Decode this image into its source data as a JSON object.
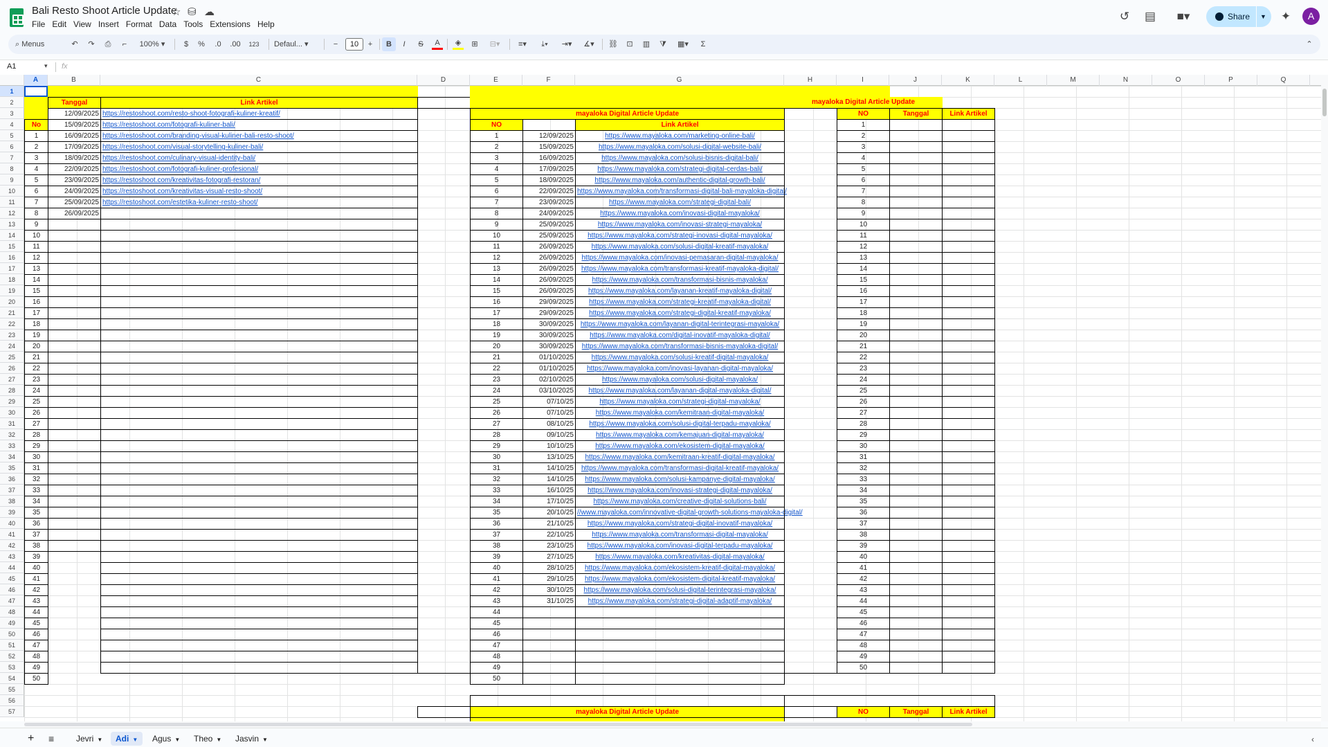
{
  "app": {
    "title": "Bali Resto Shoot Article Update",
    "menu": [
      "File",
      "Edit",
      "View",
      "Insert",
      "Format",
      "Data",
      "Tools",
      "Extensions",
      "Help"
    ],
    "share_label": "Share",
    "avatar_letter": "A",
    "accent": "#0b57d0"
  },
  "toolbar": {
    "search": "Menus",
    "zoom": "100%",
    "currency": "$",
    "percent": "%",
    "dec_less": ".0",
    "dec_more": ".00",
    "number_format": "123",
    "font": "Defaul...",
    "font_size": "10",
    "bold": "B",
    "italic": "I",
    "strike": "S",
    "text_color": "A",
    "sum": "Σ"
  },
  "formula": {
    "cell": "A1",
    "fx": "fx"
  },
  "columns": [
    "A",
    "B",
    "C",
    "D",
    "E",
    "F",
    "G",
    "H",
    "I",
    "J",
    "K",
    "L",
    "M",
    "N",
    "O",
    "P",
    "Q"
  ],
  "row_numbers": [
    "1",
    "2",
    "3",
    "4",
    "5",
    "6",
    "7",
    "8",
    "9",
    "10",
    "11",
    "12",
    "13",
    "14",
    "15",
    "16",
    "17",
    "18",
    "19",
    "20",
    "21",
    "22",
    "23",
    "24",
    "25",
    "26",
    "27",
    "28",
    "29",
    "30",
    "31",
    "32",
    "33",
    "34",
    "35",
    "36",
    "37",
    "38",
    "39",
    "40",
    "41",
    "42",
    "43",
    "44",
    "45",
    "46",
    "47",
    "48",
    "49",
    "50",
    "51",
    "52",
    "53",
    "54",
    "55",
    "56",
    "57"
  ],
  "sheet": {
    "left": {
      "h_tanggal": "Tanggal",
      "h_link": "Link Artikel",
      "h_no": "No",
      "dates": [
        "12/09/2025",
        "15/09/2025",
        "16/09/2025",
        "17/09/2025",
        "18/09/2025",
        "22/09/2025",
        "23/09/2025",
        "24/09/2025",
        "25/09/2025",
        "26/09/2025"
      ],
      "links": [
        "https://restoshoot.com/resto-shoot-fotografi-kuliner-kreatif/",
        "https://restoshoot.com/fotografi-kuliner-bali/",
        "https://restoshoot.com/branding-visual-kuliner-bali-resto-shoot/",
        "https://restoshoot.com/visual-storytelling-kuliner-bali/",
        "https://restoshoot.com/culinary-visual-identity-bali/",
        "https://restoshoot.com/fotografi-kuliner-profesional/",
        "https://restoshoot.com/kreativitas-fotografi-restoran/",
        "https://restoshoot.com/kreativitas-visual-resto-shoot/",
        "https://restoshoot.com/estetika-kuliner-resto-shoot/"
      ]
    },
    "middle": {
      "title": "mayaloka Digital Article Update",
      "h_no": "NO",
      "h_link": "Link Artikel",
      "dates": [
        "12/09/2025",
        "15/09/2025",
        "16/09/2025",
        "17/09/2025",
        "18/09/2025",
        "22/09/2025",
        "23/09/2025",
        "24/09/2025",
        "25/09/2025",
        "25/09/2025",
        "26/09/2025",
        "26/09/2025",
        "26/09/2025",
        "26/09/2025",
        "26/09/2025",
        "29/09/2025",
        "29/09/2025",
        "30/09/2025",
        "30/09/2025",
        "30/09/2025",
        "01/10/2025",
        "01/10/2025",
        "02/10/2025",
        "03/10/2025",
        "07/10/25",
        "07/10/25",
        "08/10/25",
        "09/10/25",
        "10/10/25",
        "13/10/25",
        "14/10/25",
        "14/10/25",
        "16/10/25",
        "17/10/25",
        "20/10/25",
        "21/10/25",
        "22/10/25",
        "23/10/25",
        "27/10/25",
        "28/10/25",
        "29/10/25",
        "30/10/25",
        "31/10/25"
      ],
      "links": [
        "https://www.mayaloka.com/marketing-online-bali/",
        "https://www.mayaloka.com/solusi-digital-website-bali/",
        "https://www.mayaloka.com/solusi-bisnis-digital-bali/",
        "https://www.mayaloka.com/strategi-digital-cerdas-bali/",
        "https://www.mayaloka.com/authentic-digital-growth-bali/",
        "https://www.mayaloka.com/transformasi-digital-bali-mayaloka-digital/",
        "https://www.mayaloka.com/strategi-digital-bali/",
        "https://www.mayaloka.com/inovasi-digital-mayaloka/",
        "https://www.mayaloka.com/inovasi-strategi-mayaloka/",
        "https://www.mayaloka.com/strategi-inovasi-digital-mayaloka/",
        "https://www.mayaloka.com/solusi-digital-kreatif-mayaloka/",
        "https://www.mayaloka.com/inovasi-pemasaran-digital-mayaloka/",
        "https://www.mayaloka.com/transformasi-kreatif-mayaloka-digital/",
        "https://www.mayaloka.com/transformasi-bisnis-mayaloka/",
        "https://www.mayaloka.com/layanan-kreatif-mayaloka-digital/",
        "https://www.mayaloka.com/strategi-kreatif-mayaloka-digital/",
        "https://www.mayaloka.com/strategi-digital-kreatif-mayaloka/",
        "https://www.mayaloka.com/layanan-digital-terintegrasi-mayaloka/",
        "https://www.mayaloka.com/digital-inovatif-mayaloka-digital/",
        "https://www.mayaloka.com/transformasi-bisnis-mayaloka-digital/",
        "https://www.mayaloka.com/solusi-kreatif-digital-mayaloka/",
        "https://www.mayaloka.com/inovasi-layanan-digital-mayaloka/",
        "https://www.mayaloka.com/solusi-digital-mayaloka/",
        "https://www.mayaloka.com/layanan-digital-mayaloka-digital/",
        "https://www.mayaloka.com/strategi-digital-mayaloka/",
        "https://www.mayaloka.com/kemitraan-digital-mayaloka/",
        "https://www.mayaloka.com/solusi-digital-terpadu-mayaloka/",
        "https://www.mayaloka.com/kemajuan-digital-mayaloka/",
        "https://www.mayaloka.com/ekosistem-digital-mayaloka/",
        "https://www.mayaloka.com/kemitraan-kreatif-digital-mayaloka/",
        "https://www.mayaloka.com/transformasi-digital-kreatif-mayaloka/",
        "https://www.mayaloka.com/solusi-kampanye-digital-mayaloka/",
        "https://www.mayaloka.com/inovasi-strategi-digital-mayaloka/",
        "https://www.mayaloka.com/creative-digital-solutions-bali/",
        "//www.mayaloka.com/innovative-digital-growth-solutions-mayaloka-digital/",
        "https://www.mayaloka.com/strategi-digital-inovatif-mayaloka/",
        "https://www.mayaloka.com/transformasi-digital-mayaloka/",
        "https://www.mayaloka.com/inovasi-digital-terpadu-mayaloka/",
        "https://www.mayaloka.com/kreativitas-digital-mayaloka/",
        "https://www.mayaloka.com/ekosistem-kreatif-digital-mayaloka/",
        "https://www.mayaloka.com/ekosistem-digital-kreatif-mayaloka/",
        "https://www.mayaloka.com/solusi-digital-terintegrasi-mayaloka/",
        "https://www.mayaloka.com/strategi-digital-adaptif-mayaloka/"
      ]
    },
    "right": {
      "title": "mayaloka Digital Article Update",
      "h_no": "NO",
      "h_tanggal": "Tanggal",
      "h_link": "Link Artikel"
    },
    "bottom": {
      "title": "mayaloka Digital Article Update",
      "h_no": "NO",
      "h_tanggal": "Tanggal",
      "h_link": "Link Artikel"
    }
  },
  "tabs": {
    "add": "+",
    "list": "≡",
    "names": [
      "Jevri",
      "Adi",
      "Agus",
      "Theo",
      "Jasvin"
    ],
    "active": "Adi"
  }
}
